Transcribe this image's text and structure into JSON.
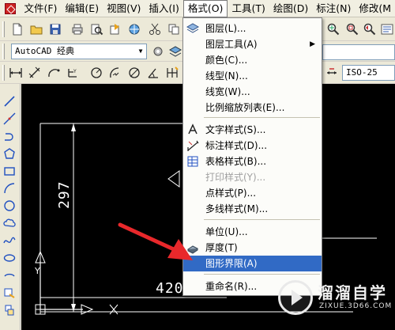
{
  "menubar": {
    "items": [
      {
        "label": "文件(F)"
      },
      {
        "label": "编辑(E)"
      },
      {
        "label": "视图(V)"
      },
      {
        "label": "插入(I)"
      },
      {
        "label": "格式(O)"
      },
      {
        "label": "工具(T)"
      },
      {
        "label": "绘图(D)"
      },
      {
        "label": "标注(N)"
      },
      {
        "label": "修改(M"
      }
    ]
  },
  "toolbar": {
    "workspace": "AutoCAD 经典",
    "dimstyle": "ISO-25"
  },
  "format_menu": {
    "items": [
      {
        "label": "图层(L)...",
        "icon": "layers-icon"
      },
      {
        "label": "图层工具(A)",
        "submenu": "▶"
      },
      {
        "label": "颜色(C)..."
      },
      {
        "label": "线型(N)..."
      },
      {
        "label": "线宽(W)..."
      },
      {
        "label": "比例缩放列表(E)..."
      },
      {
        "label": "文字样式(S)...",
        "icon": "text-style-icon"
      },
      {
        "label": "标注样式(D)...",
        "icon": "dim-style-icon"
      },
      {
        "label": "表格样式(B)...",
        "icon": "table-style-icon"
      },
      {
        "label": "打印样式(Y)...",
        "disabled": true
      },
      {
        "label": "点样式(P)..."
      },
      {
        "label": "多线样式(M)..."
      },
      {
        "label": "单位(U)..."
      },
      {
        "label": "厚度(T)",
        "icon": "thickness-icon"
      },
      {
        "label": "图形界限(A)",
        "highlight": true
      },
      {
        "label": "重命名(R)..."
      }
    ]
  },
  "drawing": {
    "dim_vertical": "297",
    "dim_horizontal": "420"
  },
  "watermark": {
    "title": "溜溜自学",
    "url": "ZIXUE.3D66.COM"
  },
  "colors": {
    "canvas": "#000000",
    "highlight": "#316ac5",
    "annotation_arrow": "#e8282b"
  }
}
